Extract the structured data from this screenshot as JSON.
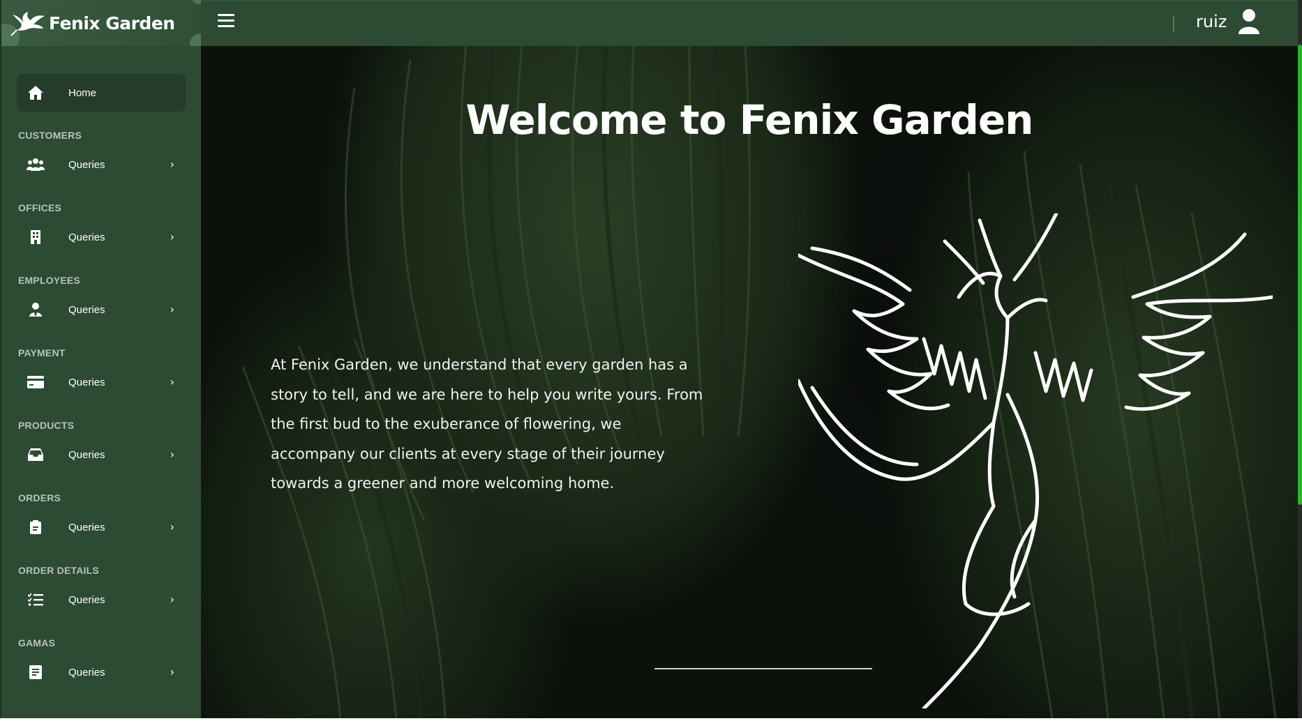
{
  "brand": {
    "name": "Fenix Garden"
  },
  "topbar": {
    "username": "ruiz"
  },
  "sidebar": {
    "home_label": "Home",
    "sections": [
      {
        "title": "CUSTOMERS",
        "item_label": "Queries",
        "icon": "users-icon"
      },
      {
        "title": "OFFICES",
        "item_label": "Queries",
        "icon": "building-icon"
      },
      {
        "title": "EMPLOYEES",
        "item_label": "Queries",
        "icon": "user-tie-icon"
      },
      {
        "title": "PAYMENT",
        "item_label": "Queries",
        "icon": "credit-card-icon"
      },
      {
        "title": "PRODUCTS",
        "item_label": "Queries",
        "icon": "inbox-icon"
      },
      {
        "title": "ORDERS",
        "item_label": "Queries",
        "icon": "clipboard-icon"
      },
      {
        "title": "ORDER DETAILS",
        "item_label": "Queries",
        "icon": "list-check-icon"
      },
      {
        "title": "GAMAS",
        "item_label": "Queries",
        "icon": "receipt-icon"
      }
    ],
    "chevron": "›"
  },
  "hero": {
    "title": "Welcome to Fenix Garden",
    "text": "At Fenix Garden, we understand that every garden has a story to tell, and we are here to help you write yours. From the first bud to the exuberance of flowering, we accompany our clients at every stage of their journey towards a greener and more welcoming home."
  },
  "colors": {
    "sidebar": "#2d4a33",
    "accent": "#27b52b",
    "background": "#0c110c"
  }
}
